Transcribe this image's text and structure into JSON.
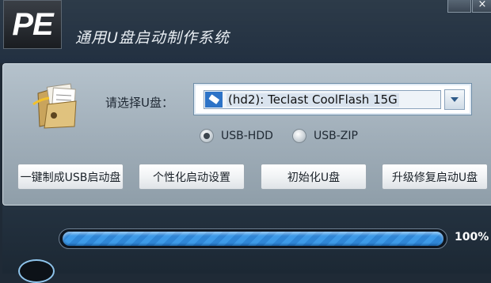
{
  "app": {
    "logo_text": "PE",
    "title": "通用U盘启动制作系统"
  },
  "window_controls": {
    "close_glyph": "×"
  },
  "device_select": {
    "label": "请选择U盘：",
    "value": "(hd2): Teclast CoolFlash 15G",
    "icon": "usb-drive-icon"
  },
  "mode_options": [
    {
      "label": "USB-HDD",
      "selected": true
    },
    {
      "label": "USB-ZIP",
      "selected": false
    }
  ],
  "actions": {
    "one_click": "一键制成USB启动盘",
    "personalize": "个性化启动设置",
    "initialize": "初始化U盘",
    "upgrade_repair": "升级修复启动U盘"
  },
  "progress": {
    "value": 1.0,
    "label": "100%"
  },
  "colors": {
    "panel": "#a9b7c2",
    "dark_bg": "#1f2a36",
    "progress_blue": "#3d9ae8"
  }
}
